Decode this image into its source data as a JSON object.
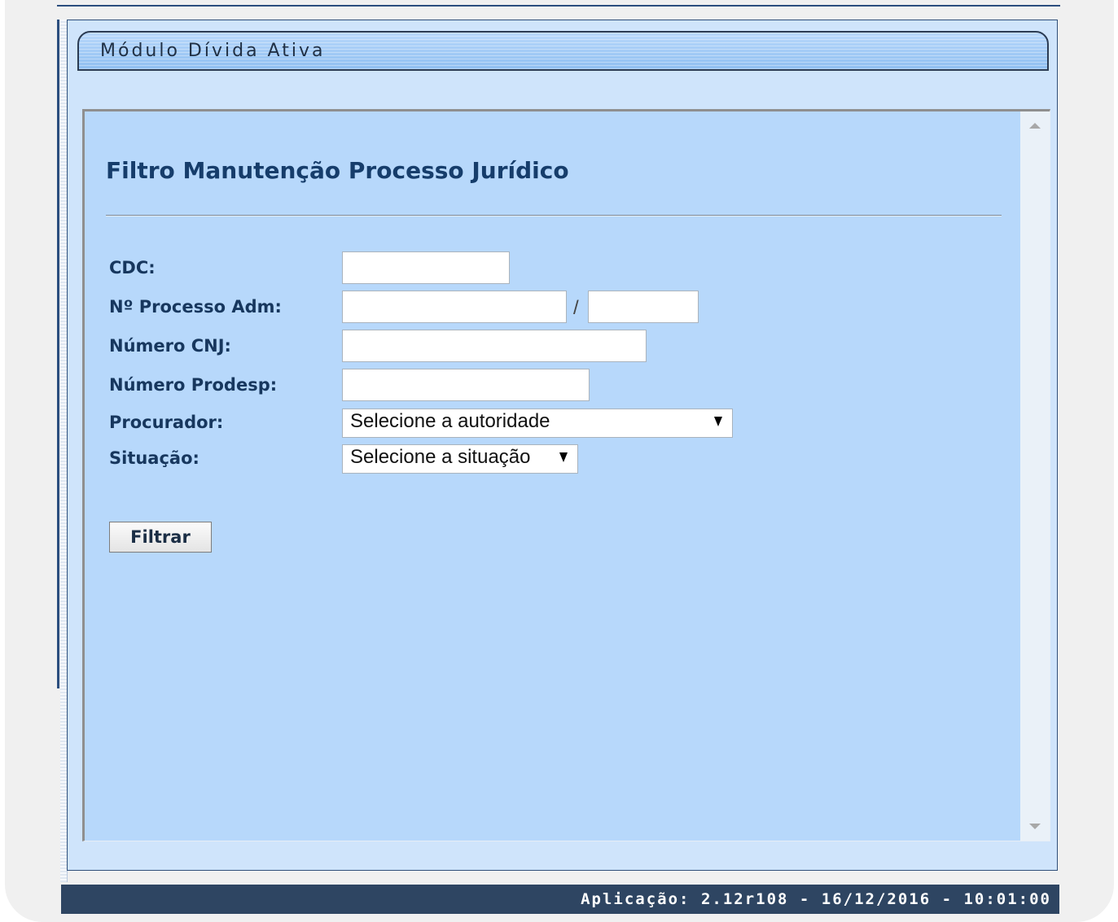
{
  "module": {
    "title": "Módulo Dívida Ativa"
  },
  "page": {
    "title": "Filtro Manutenção Processo Jurídico"
  },
  "form": {
    "cdc": {
      "label": "CDC:",
      "value": ""
    },
    "processo_adm": {
      "label": "Nº Processo Adm:",
      "value": "",
      "year_value": "",
      "separator": "/"
    },
    "numero_cnj": {
      "label": "Número CNJ:",
      "value": ""
    },
    "numero_prodesp": {
      "label": "Número Prodesp:",
      "value": ""
    },
    "procurador": {
      "label": "Procurador:",
      "selected": "Selecione a autoridade"
    },
    "situacao": {
      "label": "Situação:",
      "selected": "Selecione a situação"
    }
  },
  "actions": {
    "filter_label": "Filtrar"
  },
  "footer": {
    "app_info": "Aplicação: 2.12r108 - 16/12/2016 - 10:01:00"
  },
  "colors": {
    "header_dark": "#2e4562",
    "panel_bg": "#cfe4fb",
    "content_bg": "#b7d8fb",
    "title_text": "#163d6b"
  }
}
